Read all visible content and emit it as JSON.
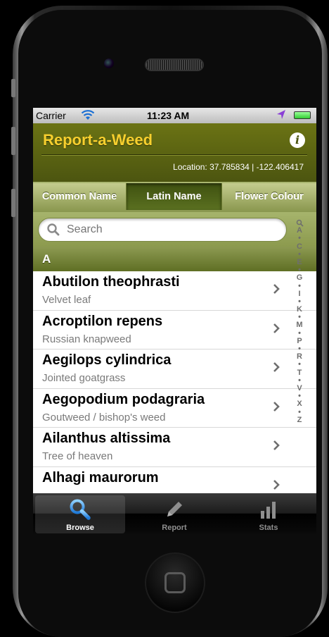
{
  "status_bar": {
    "carrier": "Carrier",
    "time": "11:23 AM"
  },
  "header": {
    "title": "Report-a-Weed",
    "location_label": "Location:",
    "location_value": "37.785834 | -122.406417"
  },
  "segments": [
    "Common Name",
    "Latin Name",
    "Flower Colour"
  ],
  "selected_segment": "Latin Name",
  "search": {
    "placeholder": "Search"
  },
  "section_header": "A",
  "items": [
    {
      "latin": "Abutilon theophrasti",
      "common": "Velvet leaf"
    },
    {
      "latin": "Acroptilon repens",
      "common": "Russian knapweed"
    },
    {
      "latin": "Aegilops cylindrica",
      "common": "Jointed goatgrass"
    },
    {
      "latin": "Aegopodium podagraria",
      "common": "Goutweed / bishop's weed"
    },
    {
      "latin": "Ailanthus altissima",
      "common": "Tree of heaven"
    },
    {
      "latin": "Alhagi maurorum",
      "common": ""
    }
  ],
  "index_letters": [
    "A",
    "•",
    "C",
    "•",
    "E",
    "•",
    "G",
    "•",
    "I",
    "•",
    "K",
    "•",
    "M",
    "•",
    "P",
    "•",
    "R",
    "•",
    "T",
    "•",
    "V",
    "•",
    "X",
    "•",
    "Z"
  ],
  "tabs": [
    {
      "label": "Browse",
      "icon": "magnifier-icon"
    },
    {
      "label": "Report",
      "icon": "pencil-icon"
    },
    {
      "label": "Stats",
      "icon": "bar-chart-icon"
    }
  ],
  "selected_tab": "Browse",
  "colors": {
    "header_green": "#5c6412",
    "title_yellow": "#f7cf2e",
    "segment_active": "#4a5e16"
  }
}
